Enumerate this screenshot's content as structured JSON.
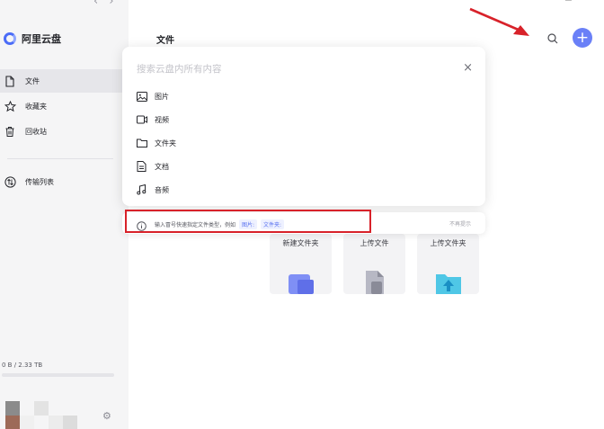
{
  "app": {
    "brand_name": "阿里云盘"
  },
  "nav_arrows": {
    "back": "‹",
    "forward": "›"
  },
  "sidebar": {
    "items": [
      {
        "label": "文件",
        "icon": "file-icon",
        "active": true
      },
      {
        "label": "收藏夹",
        "icon": "star-icon",
        "active": false
      },
      {
        "label": "回收站",
        "icon": "trash-icon",
        "active": false
      }
    ],
    "transfer": {
      "label": "传输列表",
      "icon": "transfer-icon"
    },
    "storage": {
      "text": "0 B / 2.33 TB",
      "used_fraction": 0.0
    }
  },
  "main": {
    "title": "文件",
    "add_label": "+"
  },
  "search": {
    "placeholder": "搜索云盘内所有内容",
    "close": "×",
    "options": [
      {
        "label": "图片",
        "icon": "image-icon"
      },
      {
        "label": "视频",
        "icon": "video-icon"
      },
      {
        "label": "文件夹",
        "icon": "folder-icon"
      },
      {
        "label": "文档",
        "icon": "document-icon"
      },
      {
        "label": "音频",
        "icon": "music-icon"
      }
    ]
  },
  "hint": {
    "text": "输入冒号快速指定文件类型，例如",
    "chip_1": "图片:",
    "chip_2": "文件夹:",
    "dismiss": "不再提示"
  },
  "cards": [
    {
      "label": "新建文件夹",
      "icon": "new-folder-icon"
    },
    {
      "label": "上传文件",
      "icon": "upload-file-icon"
    },
    {
      "label": "上传文件夹",
      "icon": "upload-folder-icon"
    }
  ],
  "colors": {
    "accent": "#6a80f7",
    "annotation": "#d8222a"
  }
}
